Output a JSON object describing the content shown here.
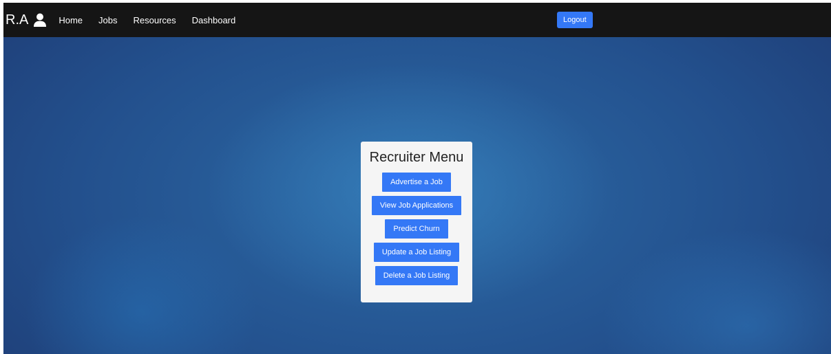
{
  "navbar": {
    "brand": "R.A",
    "brand_icon": "user-icon",
    "links": [
      {
        "label": "Home"
      },
      {
        "label": "Jobs"
      },
      {
        "label": "Resources"
      },
      {
        "label": "Dashboard"
      }
    ],
    "logout_label": "Logout"
  },
  "menu": {
    "title": "Recruiter Menu",
    "buttons": [
      {
        "label": "Advertise a Job"
      },
      {
        "label": "View Job Applications"
      },
      {
        "label": "Predict Churn"
      },
      {
        "label": "Update a Job Listing"
      },
      {
        "label": "Delete a Job Listing"
      }
    ]
  },
  "colors": {
    "navbar_bg": "#151515",
    "accent": "#3478f6",
    "background_blue": "#2c6aa6",
    "card_bg": "#f5f5f5"
  }
}
